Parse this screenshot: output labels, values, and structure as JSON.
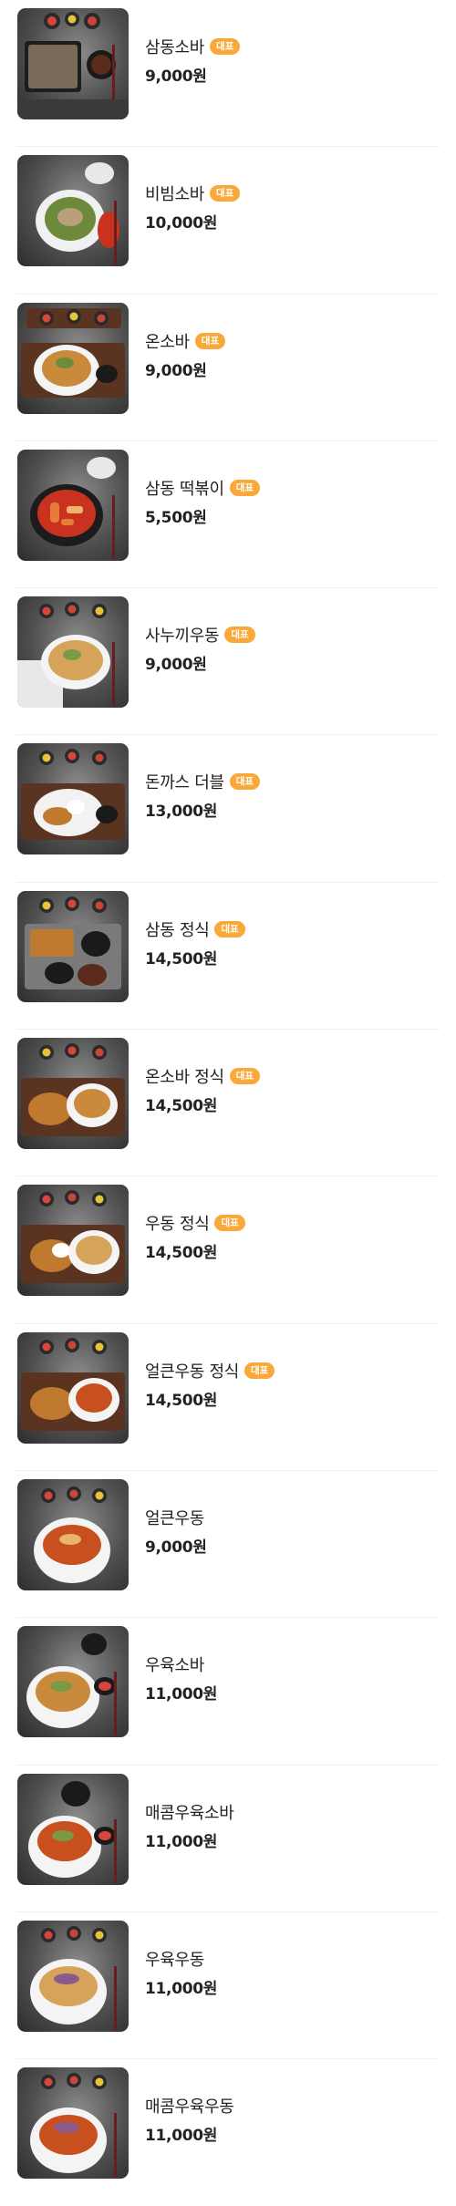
{
  "colors": {
    "badge": "#f9a83a",
    "text": "#222222",
    "divider": "#efefef"
  },
  "menu": {
    "items": [
      {
        "name": "삼동소바",
        "badge": "대표",
        "price": "9,000원",
        "photo": "zaru-soba-set-photo"
      },
      {
        "name": "비빔소바",
        "badge": "대표",
        "price": "10,000원",
        "photo": "bibim-soba-photo"
      },
      {
        "name": "온소바",
        "badge": "대표",
        "price": "9,000원",
        "photo": "hot-soba-photo"
      },
      {
        "name": "삼동 떡볶이",
        "badge": "대표",
        "price": "5,500원",
        "photo": "tteokbokki-photo"
      },
      {
        "name": "사누끼우동",
        "badge": "대표",
        "price": "9,000원",
        "photo": "sanuki-udon-photo"
      },
      {
        "name": "돈까스 더블",
        "badge": "대표",
        "price": "13,000원",
        "photo": "donkatsu-double-photo"
      },
      {
        "name": "삼동 정식",
        "badge": "대표",
        "price": "14,500원",
        "photo": "samdong-set-photo"
      },
      {
        "name": "온소바 정식",
        "badge": "대표",
        "price": "14,500원",
        "photo": "hot-soba-set-photo"
      },
      {
        "name": "우동 정식",
        "badge": "대표",
        "price": "14,500원",
        "photo": "udon-set-photo"
      },
      {
        "name": "얼큰우동 정식",
        "badge": "대표",
        "price": "14,500원",
        "photo": "spicy-udon-set-photo"
      },
      {
        "name": "얼큰우동",
        "badge": "",
        "price": "9,000원",
        "photo": "spicy-udon-photo"
      },
      {
        "name": "우육소바",
        "badge": "",
        "price": "11,000원",
        "photo": "beef-soba-photo"
      },
      {
        "name": "매콤우육소바",
        "badge": "",
        "price": "11,000원",
        "photo": "spicy-beef-soba-photo"
      },
      {
        "name": "우육우동",
        "badge": "",
        "price": "11,000원",
        "photo": "beef-udon-photo"
      },
      {
        "name": "매콤우육우동",
        "badge": "",
        "price": "11,000원",
        "photo": "spicy-beef-udon-photo"
      }
    ]
  }
}
